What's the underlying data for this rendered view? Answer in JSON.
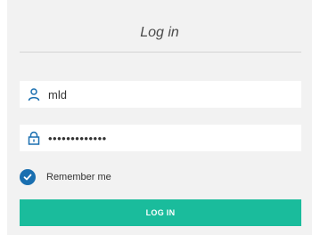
{
  "form": {
    "title": "Log in",
    "username": {
      "value": "mld",
      "icon": "user-icon"
    },
    "password": {
      "value": "•••••••••••••",
      "icon": "lock-icon"
    },
    "remember": {
      "label": "Remember me",
      "checked": true,
      "icon": "checkmark-icon"
    },
    "submit_label": "LOG IN"
  },
  "colors": {
    "panel_background": "#f2f2f2",
    "field_background": "#ffffff",
    "icon_accent": "#1a6fb0",
    "checkbox_fill": "#1a6fb0",
    "button_background": "#1abc9c",
    "button_text": "#ffffff"
  }
}
